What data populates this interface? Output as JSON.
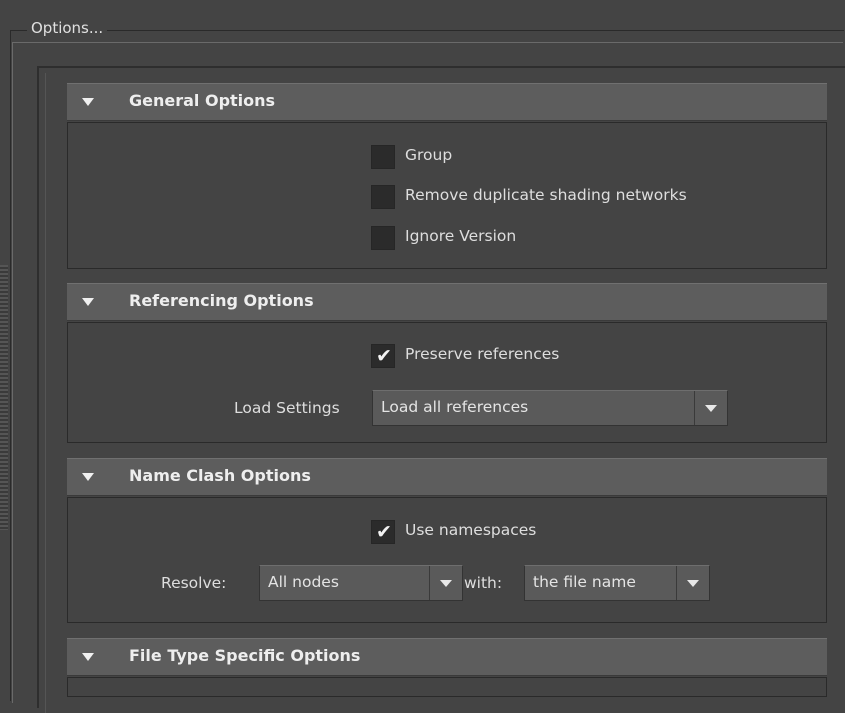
{
  "frame": {
    "legend": "Options..."
  },
  "sections": {
    "general": {
      "title": "General Options",
      "checkboxes": [
        {
          "label": "Group",
          "checked": false
        },
        {
          "label": "Remove duplicate shading networks",
          "checked": false
        },
        {
          "label": "Ignore Version",
          "checked": false
        }
      ]
    },
    "referencing": {
      "title": "Referencing Options",
      "preserve": {
        "label": "Preserve references",
        "checked": true
      },
      "load_settings": {
        "label": "Load Settings",
        "value": "Load all references"
      }
    },
    "name_clash": {
      "title": "Name Clash Options",
      "use_namespaces": {
        "label": "Use namespaces",
        "checked": true
      },
      "resolve": {
        "label": "Resolve:",
        "value": "All nodes"
      },
      "with": {
        "label": "with:",
        "value": "the file name"
      }
    },
    "file_type": {
      "title": "File Type Specific Options"
    }
  },
  "icons": {
    "expand": "triangle-down-icon",
    "dropdown": "chevron-down-icon",
    "check": "checkmark-icon"
  },
  "colors": {
    "background": "#444444",
    "header": "#5d5d5d",
    "checkbox": "#2b2b2b",
    "text": "#dcdcdc"
  }
}
